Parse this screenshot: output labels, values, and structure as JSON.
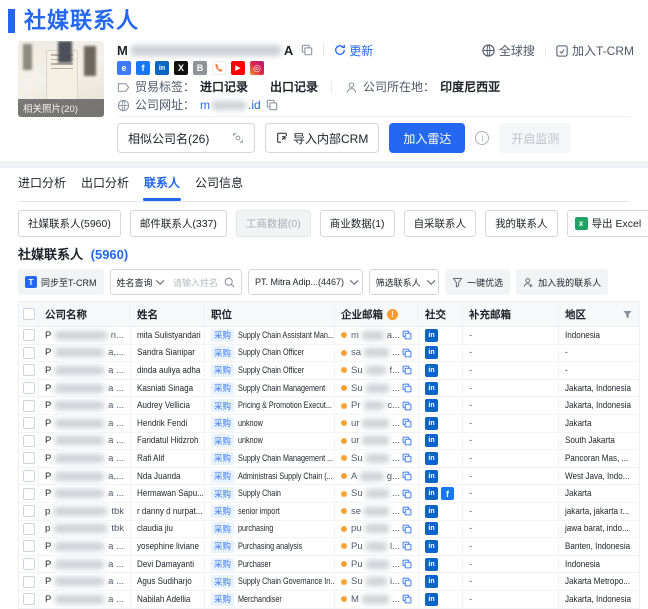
{
  "page": {
    "title": "社媒联系人"
  },
  "header": {
    "photo_label": "相关照片(20)",
    "company_name_prefix": "M",
    "company_name_suffix": "A",
    "refresh_label": "更新",
    "global_search_label": "全球搜",
    "join_tcrm_label": "加入T-CRM",
    "social_icons": [
      "website-icon",
      "facebook-icon",
      "linkedin-icon",
      "x-icon",
      "blog-icon",
      "phone-icon",
      "youtube-icon",
      "instagram-icon"
    ],
    "trade_label": "贸易标签：",
    "trade_tag_import": "进口记录",
    "trade_tag_export": "出口记录",
    "location_label": "公司所在地：",
    "location_value": "印度尼西亚",
    "website_label": "公司网址：",
    "website_prefix": "m",
    "website_suffix": ".id",
    "similar_companies_label": "相似公司名(26)",
    "import_crm_label": "导入内部CRM",
    "join_radar_label": "加入雷达",
    "monitor_label": "开启监测"
  },
  "tabs": [
    {
      "label": "进口分析"
    },
    {
      "label": "出口分析"
    },
    {
      "label": "联系人",
      "active": true
    },
    {
      "label": "公司信息"
    }
  ],
  "filter_pills": [
    {
      "label": "社媒联系人(5960)"
    },
    {
      "label": "邮件联系人(337)"
    },
    {
      "label": "工商数据(0)",
      "disabled": true
    },
    {
      "label": "商业数据(1)"
    },
    {
      "label": "自采联系人"
    },
    {
      "label": "我的联系人"
    }
  ],
  "export_label": "导出 Excel",
  "section": {
    "title": "社媒联系人",
    "count": "(5960)"
  },
  "toolbar": {
    "sync_label": "同步至T-CRM",
    "query_type": "姓名查询",
    "search_placeholder": "请输入姓名",
    "company_select": "PT. Mitra Adip...(4467)",
    "filter_contacts": "筛选联系人",
    "quick_select": "一键优选",
    "add_my_contacts": "加入我的联系人"
  },
  "table": {
    "columns": [
      "公司名称",
      "姓名",
      "职位",
      "企业邮箱",
      "社交",
      "补充邮箱",
      "地区"
    ],
    "position_tag": "采购",
    "rows": [
      {
        "company_prefix": "P",
        "company_suffix": "n...",
        "name": "mita Sulistyandari",
        "position": "Supply Chain Assistant Man...",
        "email_prefix": "m",
        "email_suffix": "a...",
        "social": [
          "linkedin"
        ],
        "extra_email": "-",
        "region": "Indonesia"
      },
      {
        "company_prefix": "P",
        "company_suffix": "a,...",
        "name": "Sandra Sianipar",
        "position": "Supply Chain Officer",
        "email_prefix": "sa",
        "email_suffix": "...",
        "social": [
          "linkedin"
        ],
        "extra_email": "-",
        "region": "-"
      },
      {
        "company_prefix": "P",
        "company_suffix": "a ...",
        "name": "dinda auliya adha",
        "position": "Supply Chain Officer",
        "email_prefix": "Su",
        "email_suffix": "f...",
        "social": [
          "linkedin"
        ],
        "extra_email": "-",
        "region": "-"
      },
      {
        "company_prefix": "P",
        "company_suffix": "a ...",
        "name": "Kasniati Sinaga",
        "position": "Supply Chain Management",
        "email_prefix": "Su",
        "email_suffix": "...",
        "social": [
          "linkedin"
        ],
        "extra_email": "-",
        "region": "Jakarta, Indonesia"
      },
      {
        "company_prefix": "P",
        "company_suffix": "a ...",
        "name": "Audrey Vellicia",
        "position": "Pricing & Promotion Execut...",
        "email_prefix": "Pr",
        "email_suffix": "c...",
        "social": [
          "linkedin"
        ],
        "extra_email": "-",
        "region": "Jakarta, Indonesia"
      },
      {
        "company_prefix": "P",
        "company_suffix": "a ...",
        "name": "Hendrik Fendi",
        "position": "unknow",
        "email_prefix": "ur",
        "email_suffix": "...",
        "social": [
          "linkedin"
        ],
        "extra_email": "-",
        "region": "Jakarta"
      },
      {
        "company_prefix": "P",
        "company_suffix": "a ...",
        "name": "Faridatul Hidzroh",
        "position": "unknow",
        "email_prefix": "ur",
        "email_suffix": "...",
        "social": [
          "linkedin"
        ],
        "extra_email": "-",
        "region": "South Jakarta"
      },
      {
        "company_prefix": "P",
        "company_suffix": "a ...",
        "name": "Rafi Alif",
        "position": "Supply Chain Management ...",
        "email_prefix": "Su",
        "email_suffix": "...",
        "social": [
          "linkedin"
        ],
        "extra_email": "-",
        "region": "Pancoran Mas, ..."
      },
      {
        "company_prefix": "P",
        "company_suffix": "a,...",
        "name": "Nda Juanda",
        "position": "Administrasi Supply Chain (...",
        "email_prefix": "A",
        "email_suffix": "g...",
        "social": [
          "linkedin"
        ],
        "extra_email": "-",
        "region": "West Java, Indo..."
      },
      {
        "company_prefix": "P",
        "company_suffix": "a ...",
        "name": "Hermawan Sapu...",
        "position": "Supply Chain",
        "email_prefix": "Su",
        "email_suffix": "...",
        "social": [
          "linkedin",
          "facebook"
        ],
        "extra_email": "-",
        "region": "Jakarta"
      },
      {
        "company_prefix": "p",
        "company_suffix": "tbk",
        "name": "r danny d nurpat...",
        "position": "senior import",
        "email_prefix": "se",
        "email_suffix": "...",
        "social": [
          "linkedin"
        ],
        "extra_email": "-",
        "region": "jakarta, jakarta r..."
      },
      {
        "company_prefix": "p",
        "company_suffix": "tbk",
        "name": "claudia jiu",
        "position": "purchasing",
        "email_prefix": "pu",
        "email_suffix": "...",
        "social": [
          "linkedin"
        ],
        "extra_email": "-",
        "region": "jawa barat, indo..."
      },
      {
        "company_prefix": "P",
        "company_suffix": "a ...",
        "name": "yosephine liviane",
        "position": "Purchasing analysis",
        "email_prefix": "Pu",
        "email_suffix": "l...",
        "social": [
          "linkedin"
        ],
        "extra_email": "-",
        "region": "Banten, Indonesia"
      },
      {
        "company_prefix": "P",
        "company_suffix": "a ...",
        "name": "Devi Damayanti",
        "position": "Purchaser",
        "email_prefix": "Pu",
        "email_suffix": "...",
        "social": [
          "linkedin"
        ],
        "extra_email": "-",
        "region": "Indonesia"
      },
      {
        "company_prefix": "P",
        "company_suffix": "a ...",
        "name": "Agus Sudiharjo",
        "position": "Supply Chain Governance In...",
        "email_prefix": "Su",
        "email_suffix": "i...",
        "social": [
          "linkedin"
        ],
        "extra_email": "-",
        "region": "Jakarta Metropo..."
      },
      {
        "company_prefix": "P",
        "company_suffix": "a ...",
        "name": "Nabilah Adellia",
        "position": "Merchandiser",
        "email_prefix": "M",
        "email_suffix": "...",
        "social": [
          "linkedin"
        ],
        "extra_email": "-",
        "region": "Jakarta, Indonesia"
      }
    ]
  }
}
